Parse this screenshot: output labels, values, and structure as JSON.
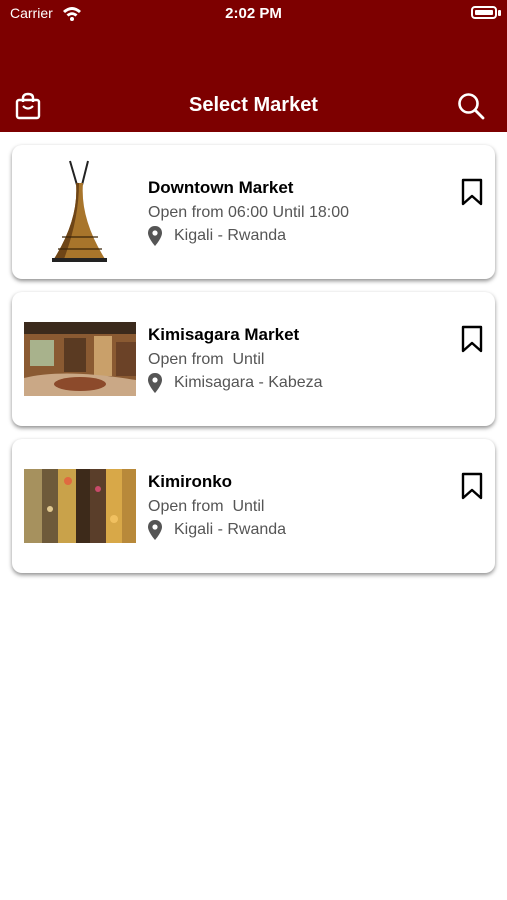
{
  "status_bar": {
    "carrier": "Carrier",
    "time": "2:02 PM"
  },
  "header": {
    "title": "Select Market",
    "left_icon": "shopping-bag-icon",
    "right_icon": "search-icon"
  },
  "colors": {
    "header_bg": "#7d0000",
    "card_bg": "#ffffff",
    "secondary_text": "#555555"
  },
  "markets": [
    {
      "name": "Downtown Market",
      "hours": "Open from 06:00 Until 18:00",
      "location": "Kigali - Rwanda",
      "image": "tower-image"
    },
    {
      "name": "Kimisagara Market",
      "hours": "Open from  Until",
      "location": "Kimisagara - Kabeza",
      "image": "interior-image"
    },
    {
      "name": "Kimironko",
      "hours": "Open from  Until",
      "location": "Kigali - Rwanda",
      "image": "grains-image"
    }
  ]
}
